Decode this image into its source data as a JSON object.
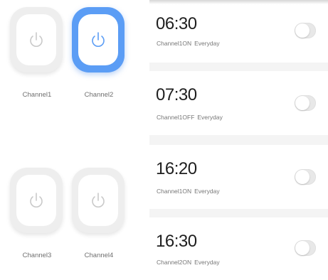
{
  "channels": [
    {
      "label": "Channel1",
      "active": false
    },
    {
      "label": "Channel2",
      "active": true
    },
    {
      "label": "Channel3",
      "active": false
    },
    {
      "label": "Channel4",
      "active": false
    }
  ],
  "schedules": [
    {
      "time": "06:30",
      "channel_action": "Channel1ON",
      "repeat": "Everyday",
      "enabled": false
    },
    {
      "time": "07:30",
      "channel_action": "Channel1OFF",
      "repeat": "Everyday",
      "enabled": false
    },
    {
      "time": "16:20",
      "channel_action": "Channel1ON",
      "repeat": "Everyday",
      "enabled": false
    },
    {
      "time": "16:30",
      "channel_action": "Channel2ON",
      "repeat": "Everyday",
      "enabled": false
    }
  ],
  "colors": {
    "active_accent": "#5b9df5",
    "icon_inactive": "#c9c9c9",
    "icon_active": "#5b9df5"
  }
}
